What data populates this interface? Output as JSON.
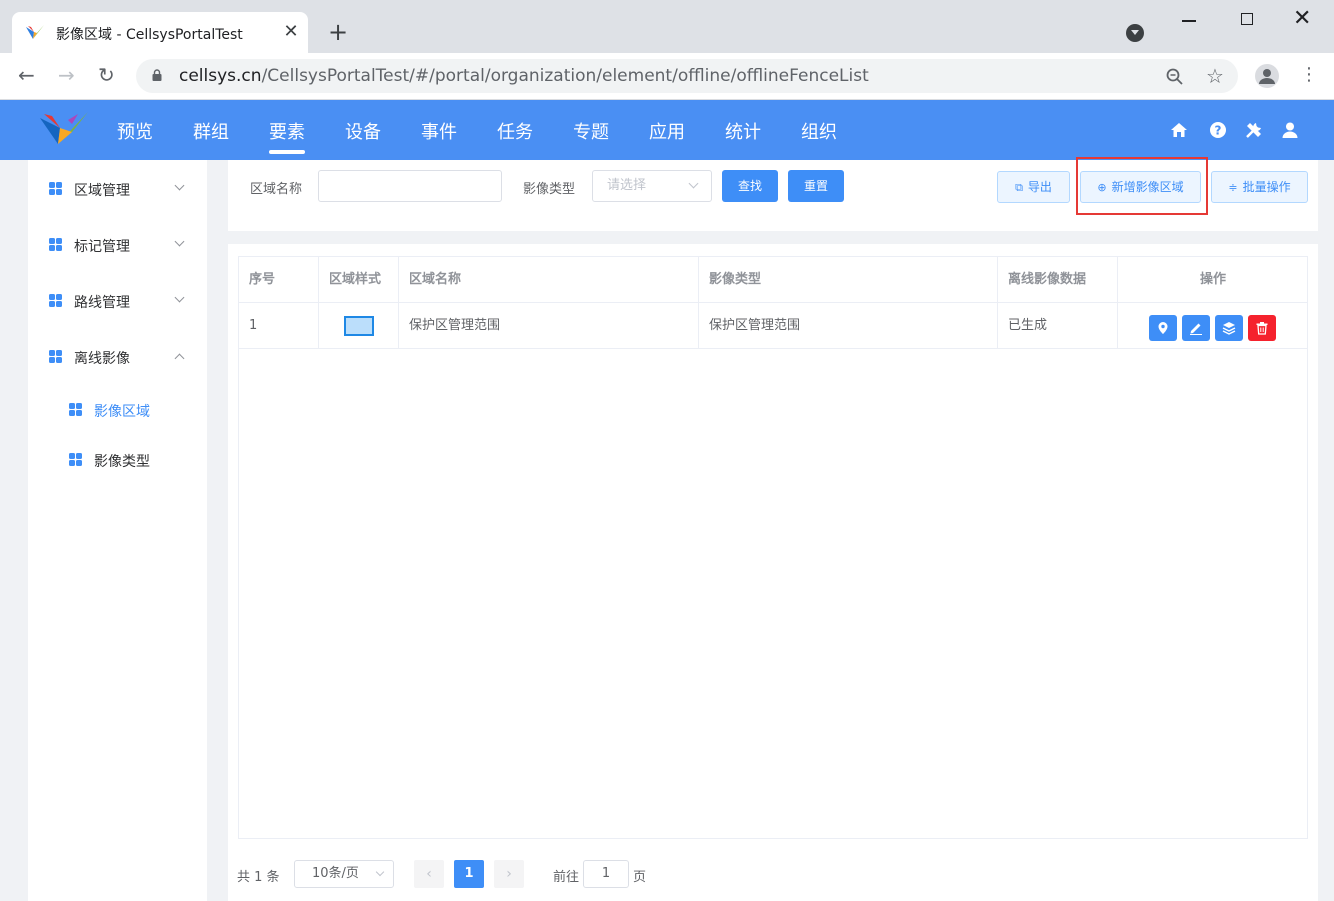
{
  "browser": {
    "tab_title": "影像区域 - CellsysPortalTest",
    "url_host": "cellsys.cn",
    "url_path": "/CellsysPortalTest/#/portal/organization/element/offline/offlineFenceList"
  },
  "nav": {
    "items": [
      "预览",
      "群组",
      "要素",
      "设备",
      "事件",
      "任务",
      "专题",
      "应用",
      "统计",
      "组织"
    ],
    "active": "要素"
  },
  "sidebar": {
    "groups": [
      {
        "label": "区域管理",
        "expanded": false
      },
      {
        "label": "标记管理",
        "expanded": false
      },
      {
        "label": "路线管理",
        "expanded": false
      },
      {
        "label": "离线影像",
        "expanded": true
      }
    ],
    "subitems": [
      {
        "label": "影像区域",
        "active": true
      },
      {
        "label": "影像类型",
        "active": false
      }
    ]
  },
  "filter": {
    "name_label": "区域名称",
    "name_value": "",
    "type_label": "影像类型",
    "type_placeholder": "请选择",
    "search_label": "查找",
    "reset_label": "重置",
    "export_label": "导出",
    "add_label": "新增影像区域",
    "batch_label": "批量操作"
  },
  "table": {
    "headers": [
      "序号",
      "区域样式",
      "区域名称",
      "影像类型",
      "离线影像数据",
      "操作"
    ],
    "rows": [
      {
        "index": "1",
        "name": "保护区管理范围",
        "type": "保护区管理范围",
        "data": "已生成"
      }
    ]
  },
  "pagination": {
    "total": "共 1 条",
    "page_size": "10条/页",
    "current": "1",
    "goto_prefix": "前往",
    "goto_value": "1",
    "goto_suffix": "页"
  },
  "colors": {
    "brand": "#4a8ff3",
    "primary": "#3e8ef7",
    "danger": "#f5222d",
    "highlight": "#e53935"
  }
}
